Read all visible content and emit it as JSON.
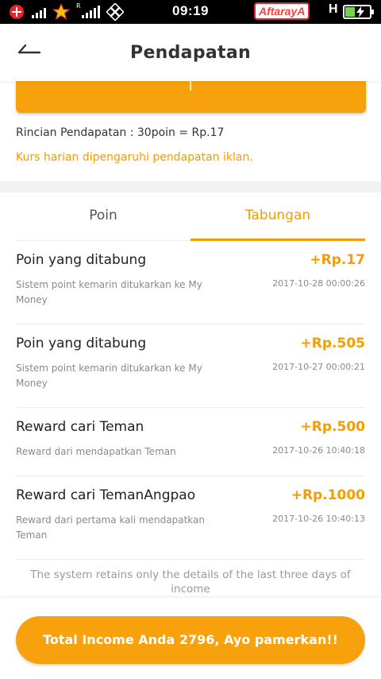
{
  "status_bar": {
    "time": "09:19",
    "carrier_brand": "AftarayA",
    "network_letter": "H",
    "signal_label": "R",
    "icons": [
      "telkomsel-logo-icon",
      "signal-bars-icon",
      "star-logo-icon",
      "signal-bars-icon",
      "grid-logo-icon",
      "battery-charging-icon"
    ]
  },
  "header": {
    "title": "Pendapatan",
    "back_icon": "back-arrow-icon"
  },
  "summary": {
    "rincian": "Rincian Pendapatan : 30poin = Rp.17",
    "kurs_note": "Kurs harian dipengaruhi pendapatan iklan."
  },
  "tabs": [
    {
      "label": "Poin",
      "active": false
    },
    {
      "label": "Tabungan",
      "active": true
    }
  ],
  "transactions": [
    {
      "title": "Poin yang ditabung",
      "amount": "+Rp.17",
      "description": "Sistem point kemarin ditukarkan ke My Money",
      "timestamp": "2017-10-28 00:00:26"
    },
    {
      "title": "Poin yang ditabung",
      "amount": "+Rp.505",
      "description": "Sistem point kemarin ditukarkan ke My Money",
      "timestamp": "2017-10-27 00:00:21"
    },
    {
      "title": "Reward cari Teman",
      "amount": "+Rp.500",
      "description": "Reward dari mendapatkan Teman",
      "timestamp": "2017-10-26 10:40:18"
    },
    {
      "title": "Reward cari TemanAngpao",
      "amount": "+Rp.1000",
      "description": "Reward dari pertama kali mendapatkan Teman",
      "timestamp": "2017-10-26 10:40:13"
    }
  ],
  "footer_note": "The system retains only the details of the last three days of income",
  "share_button": {
    "label": "Total Income Anda 2796, Ayo pamerkan!!"
  },
  "colors": {
    "accent": "#f7a20c",
    "accent_text": "#f59c00",
    "muted_text": "#8a8a8a"
  }
}
